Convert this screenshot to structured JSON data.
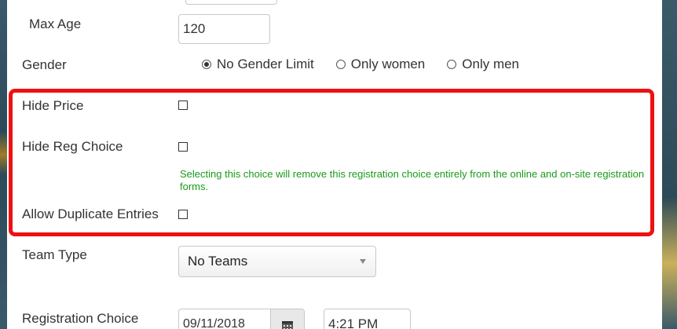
{
  "form": {
    "max_age": {
      "label": "Max Age",
      "value": "120"
    },
    "gender": {
      "label": "Gender",
      "options": [
        {
          "label": "No Gender Limit",
          "checked": true
        },
        {
          "label": "Only women",
          "checked": false
        },
        {
          "label": "Only men",
          "checked": false
        }
      ]
    },
    "hide_price": {
      "label": "Hide Price",
      "checked": false
    },
    "hide_reg_choice": {
      "label": "Hide Reg Choice",
      "checked": false,
      "help": "Selecting this choice will remove this registration choice entirely from the online and on-site registration forms."
    },
    "allow_duplicate": {
      "label": "Allow Duplicate Entries",
      "checked": false
    },
    "team_type": {
      "label": "Team Type",
      "selected": "No Teams"
    },
    "registration_choice": {
      "label": "Registration Choice",
      "date": "09/11/2018",
      "time": "4:21 PM"
    }
  },
  "colors": {
    "highlight": "#ee1111",
    "help_text": "#1a9a1a"
  },
  "icons": {
    "calendar": "calendar-icon",
    "select_caret": "caret-down-icon"
  }
}
